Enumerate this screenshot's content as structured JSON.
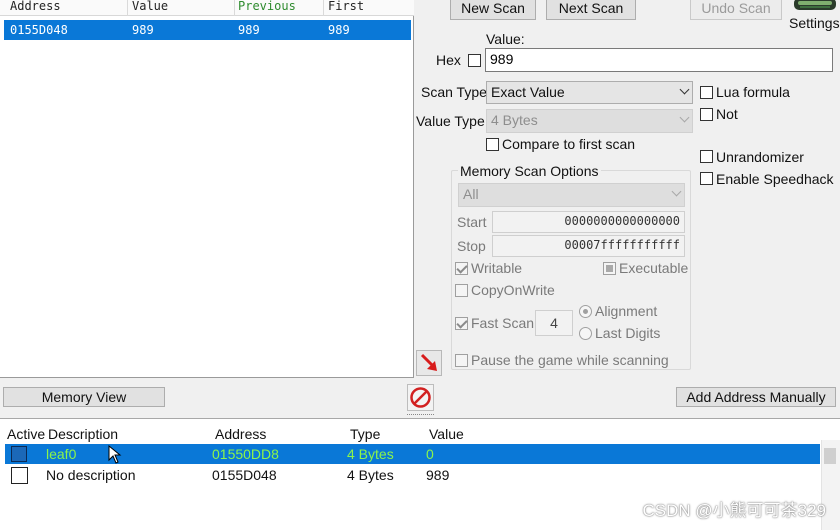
{
  "results_list": {
    "columns": [
      "Address",
      "Value",
      "Previous",
      "First"
    ],
    "rows": [
      {
        "address": "0155D048",
        "value": "989",
        "previous": "989",
        "first": "989"
      }
    ]
  },
  "scan_buttons": {
    "new_scan": "New Scan",
    "next_scan": "Next Scan",
    "undo_scan": "Undo Scan",
    "settings": "Settings"
  },
  "value_section": {
    "value_label": "Value:",
    "hex_label": "Hex",
    "value": "989"
  },
  "scan_type": {
    "label": "Scan Type",
    "selected": "Exact Value"
  },
  "value_type": {
    "label": "Value Type",
    "selected": "4 Bytes"
  },
  "compare_first_label": "Compare to first scan",
  "lua_formula_label": "Lua formula",
  "not_label": "Not",
  "unrandomizer_label": "Unrandomizer",
  "speedhack_label": "Enable Speedhack",
  "memory_scan_options": {
    "title": "Memory Scan Options",
    "region": "All",
    "start_label": "Start",
    "start_value": "0000000000000000",
    "stop_label": "Stop",
    "stop_value": "00007fffffffffff",
    "writable_label": "Writable",
    "executable_label": "Executable",
    "copyonwrite_label": "CopyOnWrite",
    "fast_scan_label": "Fast Scan",
    "fast_scan_value": "4",
    "alignment_label": "Alignment",
    "last_digits_label": "Last Digits",
    "pause_label": "Pause the game while scanning"
  },
  "toolbar": {
    "memory_view": "Memory View",
    "add_address_manually": "Add Address Manually"
  },
  "address_table": {
    "columns": [
      "Active",
      "Description",
      "Address",
      "Type",
      "Value"
    ],
    "rows": [
      {
        "description": "leaf0",
        "address": "01550DD8",
        "type": "4 Bytes",
        "value": "0"
      },
      {
        "description": "No description",
        "address": "0155D048",
        "type": "4 Bytes",
        "value": "989"
      }
    ]
  },
  "watermark": "CSDN @小熊可可茶329",
  "colors": {
    "selection": "#0a78d7",
    "selected_text": "#8cf54a",
    "arrow_red": "#d81b1b"
  }
}
